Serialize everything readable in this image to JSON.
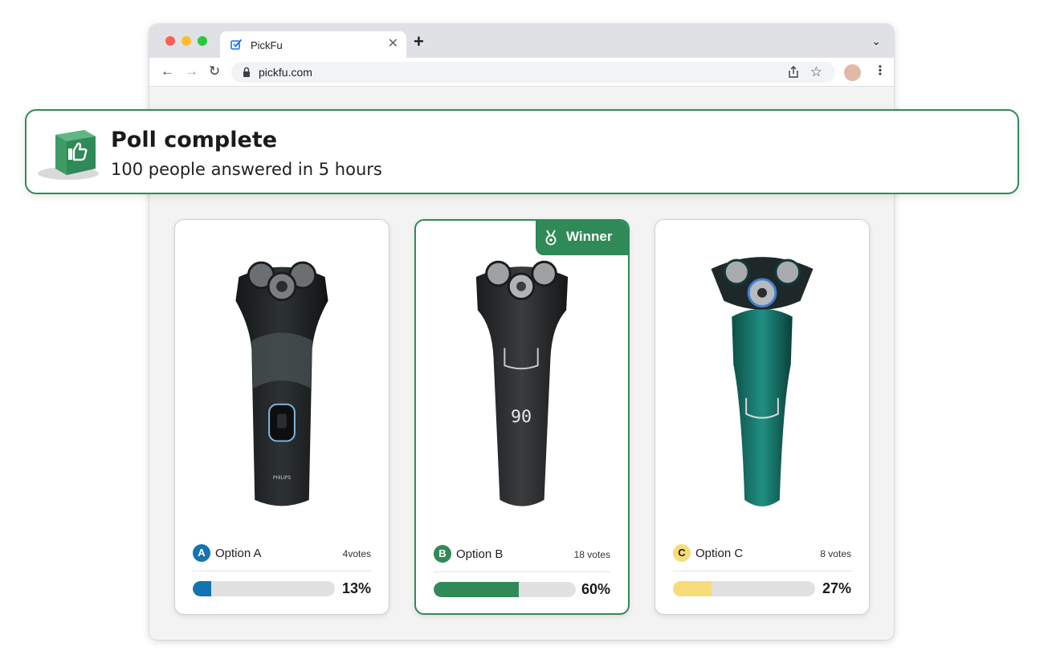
{
  "browser": {
    "tab_title": "PickFu",
    "tab_close": "✕",
    "new_tab": "+",
    "tab_menu": "⌄",
    "url": "pickfu.com",
    "nav_back": "←",
    "nav_forward": "→",
    "nav_reload": "↻",
    "star": "☆",
    "menu": "⋮"
  },
  "banner": {
    "title": "Poll complete",
    "subtitle": "100 people answered in 5 hours"
  },
  "winner_label": "Winner",
  "options": [
    {
      "letter": "A",
      "name": "Option A",
      "votes": "4votes",
      "percent_label": "13%",
      "percent": 13,
      "color": "#1474b0",
      "letter_text_color": "#ffffff"
    },
    {
      "letter": "B",
      "name": "Option B",
      "votes": "18 votes",
      "percent_label": "60%",
      "percent": 60,
      "color": "#2f8a58",
      "letter_text_color": "#ffffff"
    },
    {
      "letter": "C",
      "name": "Option C",
      "votes": "8 votes",
      "percent_label": "27%",
      "percent": 27,
      "color": "#f8dc7a",
      "letter_text_color": "#1a1a1a"
    }
  ],
  "colors": {
    "accent": "#2f8a58",
    "track": "#e1e1e1"
  }
}
